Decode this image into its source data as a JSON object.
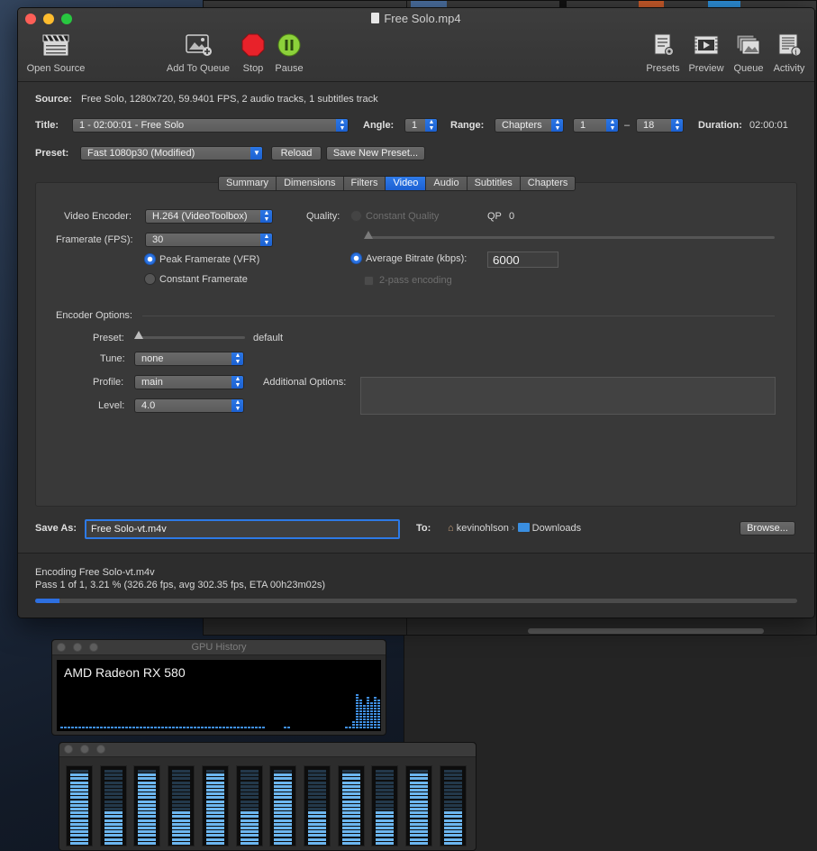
{
  "window": {
    "title": "Free Solo.mp4",
    "colors": {
      "close": "#fe5f57",
      "minimize": "#febc2e",
      "zoom": "#28c840",
      "accent": "#2b73e2"
    }
  },
  "toolbar": {
    "open_source": "Open Source",
    "add_to_queue": "Add To Queue",
    "stop": "Stop",
    "pause": "Pause",
    "presets": "Presets",
    "preview": "Preview",
    "queue": "Queue",
    "activity": "Activity"
  },
  "source": {
    "label": "Source:",
    "value": "Free Solo, 1280x720, 59.9401 FPS, 2 audio tracks, 1 subtitles track"
  },
  "title_row": {
    "title_label": "Title:",
    "title_value": "1 - 02:00:01 - Free Solo",
    "angle_label": "Angle:",
    "angle_value": "1",
    "range_label": "Range:",
    "range_mode": "Chapters",
    "range_start": "1",
    "range_dash": "–",
    "range_end": "18",
    "duration_label": "Duration:",
    "duration_value": "02:00:01"
  },
  "preset_row": {
    "label": "Preset:",
    "value": "Fast 1080p30 (Modified)",
    "reload": "Reload",
    "save_new": "Save New Preset..."
  },
  "tabs": [
    {
      "label": "Summary",
      "active": false
    },
    {
      "label": "Dimensions",
      "active": false
    },
    {
      "label": "Filters",
      "active": false
    },
    {
      "label": "Video",
      "active": true
    },
    {
      "label": "Audio",
      "active": false
    },
    {
      "label": "Subtitles",
      "active": false
    },
    {
      "label": "Chapters",
      "active": false
    }
  ],
  "video": {
    "encoder_label": "Video Encoder:",
    "encoder_value": "H.264 (VideoToolbox)",
    "framerate_label": "Framerate (FPS):",
    "framerate_value": "30",
    "peak_framerate": "Peak Framerate (VFR)",
    "constant_framerate": "Constant Framerate",
    "quality_label": "Quality:",
    "constant_quality": "Constant Quality",
    "qp_label": "QP",
    "qp_value": "0",
    "avg_bitrate_label": "Average Bitrate (kbps):",
    "avg_bitrate_value": "6000",
    "two_pass": "2-pass encoding"
  },
  "encoder_options": {
    "header": "Encoder Options:",
    "preset_label": "Preset:",
    "preset_value": "default",
    "tune_label": "Tune:",
    "tune_value": "none",
    "profile_label": "Profile:",
    "profile_value": "main",
    "level_label": "Level:",
    "level_value": "4.0",
    "additional_label": "Additional Options:"
  },
  "save": {
    "label": "Save As:",
    "filename": "Free Solo-vt.m4v",
    "to_label": "To:",
    "path_user": "kevinohlson",
    "path_sep": "›",
    "path_folder": "Downloads",
    "browse": "Browse..."
  },
  "status": {
    "line1": "Encoding Free Solo-vt.m4v",
    "line2": "Pass 1 of 1, 3.21 % (326.26 fps, avg 302.35 fps, ETA 00h23m02s)",
    "progress_percent": 3.21
  },
  "gpu": {
    "window_title": "GPU History",
    "gpu_name": "AMD Radeon RX 580"
  }
}
